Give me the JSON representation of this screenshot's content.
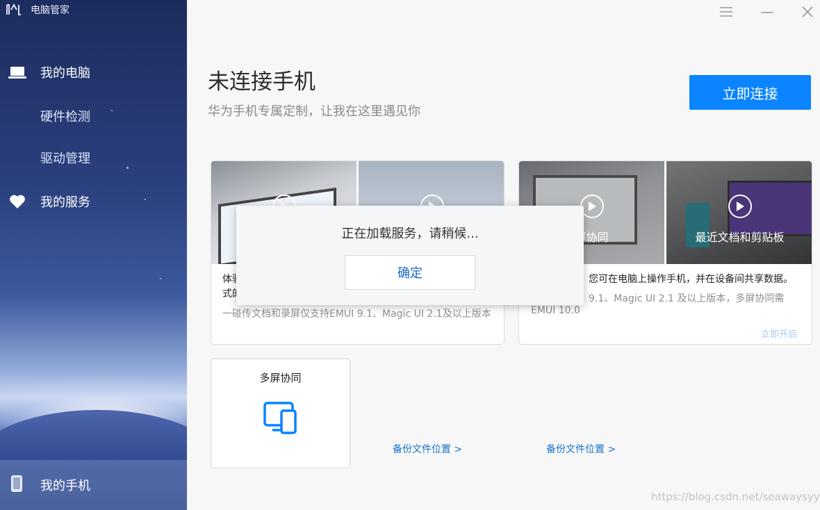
{
  "app": {
    "title": "电脑管家"
  },
  "sidebar": {
    "items": [
      {
        "label": "我的电脑",
        "icon": "laptop-icon"
      },
      {
        "label": "硬件检测"
      },
      {
        "label": "驱动管理"
      },
      {
        "label": "我的服务",
        "icon": "heart-icon"
      }
    ],
    "phone": {
      "label": "我的手机",
      "icon": "phone-icon"
    }
  },
  "window_controls": [
    "menu-icon",
    "minimize-icon",
    "close-icon"
  ],
  "main": {
    "title": "未连接手机",
    "subtitle": "华为手机专属定制，让我在这里遇见你",
    "connect_button": "立即连接",
    "card_left": {
      "text_line1": "体验",
      "text_line2": "式的",
      "note": "一碰传文档和录屏仅支持EMUI 9.1、Magic UI 2.1及以上版本"
    },
    "card_right": {
      "video1_caption": "屏协同",
      "video2_caption": "最近文档和剪贴板",
      "text": "您可在电脑上操作手机，并在设备间共享数据。",
      "note_line1": "9.1、Magic UI 2.1 及以上版本，多屏协同需",
      "note_line2": "EMUI 10.0",
      "link": "立即开启"
    },
    "multi_screen_card": {
      "title": "多屏协同",
      "icon": "multi-device-icon"
    },
    "backup_links": [
      "备份文件位置 >",
      "备份文件位置 >"
    ],
    "watermark": "https://blog.csdn.net/seawaysyyy"
  },
  "modal": {
    "message": "正在加载服务，请稍候...",
    "ok_button": "确定"
  },
  "colors": {
    "accent": "#0a84ff",
    "link": "#1a73c9"
  }
}
